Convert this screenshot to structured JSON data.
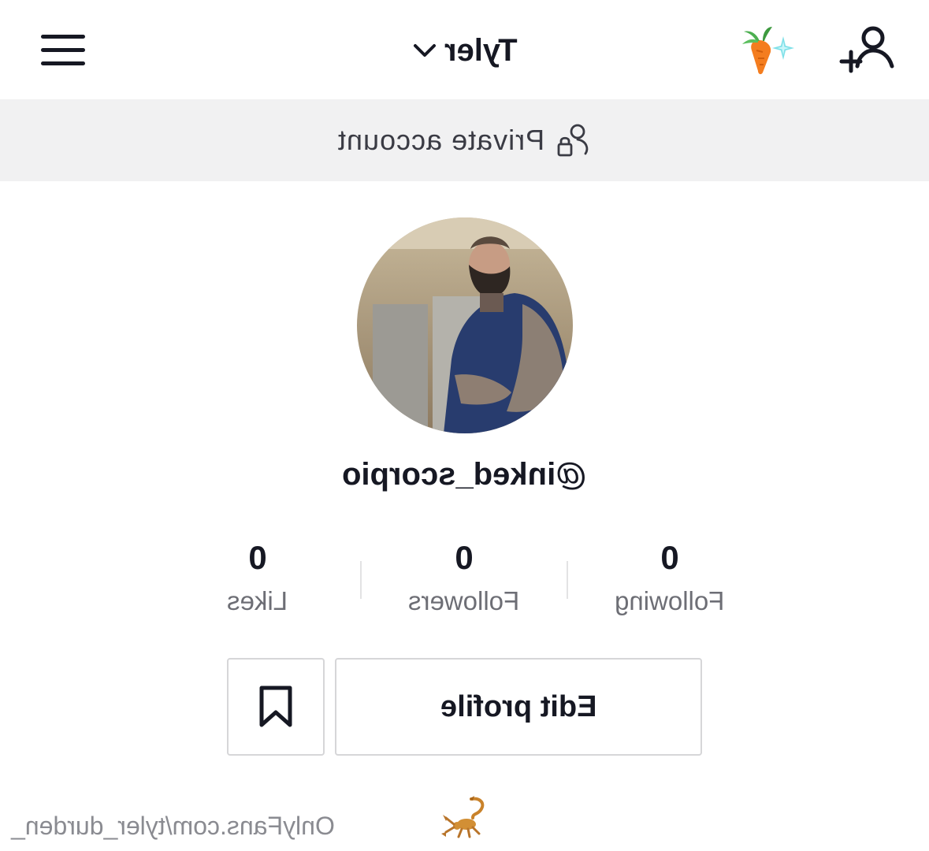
{
  "header": {
    "title": "Tyler",
    "menu_icon": "hamburger-menu-icon",
    "carrot_icon": "carrot-sparkle-icon",
    "add_user_icon": "add-user-icon"
  },
  "banner": {
    "text": "Private account",
    "icon": "lock-user-icon"
  },
  "profile": {
    "username": "@inked_scorpio"
  },
  "stats": [
    {
      "value": "0",
      "label": "Following"
    },
    {
      "value": "0",
      "label": "Followers"
    },
    {
      "value": "0",
      "label": "Likes"
    }
  ],
  "actions": {
    "edit_label": "Edit profile",
    "bookmark_icon": "bookmark-icon"
  },
  "bio": {
    "emoji": "scorpion-icon",
    "link": "OnlyFans.com/tyler_durden_"
  },
  "colors": {
    "text": "#161823",
    "muted": "#6d6e75",
    "banner_bg": "#f1f1f2",
    "border": "#d6d6d8"
  }
}
